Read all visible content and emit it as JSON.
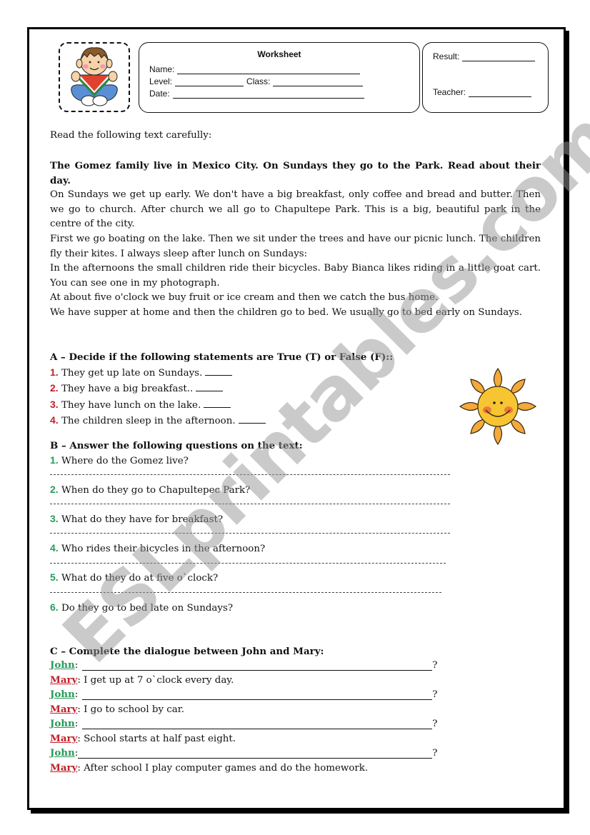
{
  "header": {
    "title": "Worksheet",
    "name_label": "Name:",
    "level_label": "Level:",
    "class_label": "Class:",
    "date_label": "Date:",
    "result_label": "Result:",
    "teacher_label": "Teacher:"
  },
  "intro": "Read the following text carefully:",
  "reading": {
    "title": "The Gomez family live in Mexico City. On Sundays they go to the Park. Read about their day.",
    "paragraphs": [
      "On Sundays we get up early. We don't have a big breakfast, only coffee and bread and butter. Then we go to church. After church we all go to Chapultepe Park. This is a big, beautiful park in the centre of the city.",
      "First we go boating on the lake. Then we sit under the trees and have our picnic lunch. The children fly their kites. I always sleep after lunch on Sundays:",
      "In the afternoons the small children ride their bicycles. Baby Bianca likes riding in a little goat cart. You can see one in my photograph.",
      "At about five o'clock we buy fruit or ice cream and then we catch the bus home.",
      "We have supper at home and then the children go to bed. We usually go to bed early on Sundays."
    ]
  },
  "section_a": {
    "title": "A – Decide if the following statements are True (T) or False (F)::",
    "items": [
      {
        "num": "1.",
        "text": "They get up late on Sundays."
      },
      {
        "num": "2.",
        "text": "They have a big breakfast.."
      },
      {
        "num": "3.",
        "text": "They have lunch on the lake."
      },
      {
        "num": "4.",
        "text": "The children sleep in the afternoon."
      }
    ]
  },
  "section_b": {
    "title": "B – Answer the following questions on the text:",
    "items": [
      {
        "num": "1.",
        "text": "Where do the Gomez live?"
      },
      {
        "num": "2.",
        "text": "When do they go to Chapultepec Park?"
      },
      {
        "num": "3.",
        "text": "What do they have for breakfast?"
      },
      {
        "num": "4.",
        "text": "Who rides their bicycles in the afternoon?"
      },
      {
        "num": "5.",
        "text": "What do they do at five o`clock?"
      },
      {
        "num": "6.",
        "text": "Do they go to bed late on Sundays?"
      }
    ]
  },
  "section_c": {
    "title": "C – Complete the dialogue between John and Mary:",
    "lines": [
      {
        "speaker": "John",
        "text": "",
        "end": "?"
      },
      {
        "speaker": "Mary",
        "text": " I get up at 7 o`clock every day."
      },
      {
        "speaker": "John",
        "text": "",
        "end": "?"
      },
      {
        "speaker": "Mary",
        "text": " I go to school by car."
      },
      {
        "speaker": "John",
        "text": "",
        "end": "?"
      },
      {
        "speaker": "Mary",
        "text": " School starts at half past eight."
      },
      {
        "speaker": "John",
        "text": "",
        "end": "?"
      },
      {
        "speaker": "Mary",
        "text": " After school I play computer games and do the homework."
      }
    ],
    "colon": ":"
  },
  "watermark": "ESLprintables.com",
  "colors": {
    "red_accent": "#c0202a",
    "green_accent": "#2a9a5a",
    "sun_petal": "#f4a93a",
    "sun_face": "#f7c531"
  }
}
